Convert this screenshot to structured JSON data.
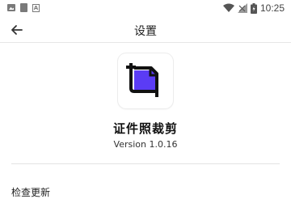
{
  "status_bar": {
    "time": "10:25",
    "icons": [
      "gallery-icon",
      "sd-card-icon",
      "a-badge-icon",
      "wifi-icon",
      "no-signal-icon",
      "battery-charging-icon"
    ]
  },
  "toolbar": {
    "title": "设置",
    "back_icon": "arrow-left-icon"
  },
  "about": {
    "app_name": "证件照裁剪",
    "version": "Version 1.0.16",
    "icon": "crop-document-icon",
    "accent_color": "#5b3cf5"
  },
  "menu": {
    "check_update": "检查更新"
  }
}
